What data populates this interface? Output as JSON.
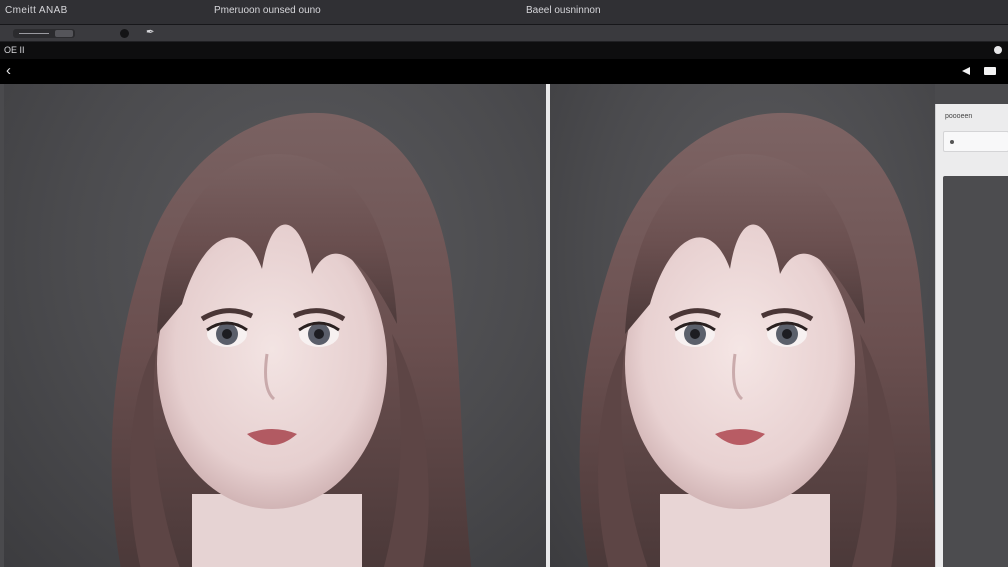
{
  "titlebar": {
    "app_title": "Cmeitt ANAB",
    "doc_title": "Pmeruoon ounsed ouno",
    "right_title": "Baeel ousninnon"
  },
  "toolbar": {
    "slider_value": "",
    "brush_glyph": "✒"
  },
  "subbar": {
    "label": "OE II"
  },
  "navbar": {
    "back_glyph": "‹"
  },
  "properties": {
    "title": "poooeen",
    "field_value": "•"
  },
  "colors": {
    "chrome_dark": "#303034",
    "canvas_bg": "#4a4a4d",
    "split_line": "#e9e9ea",
    "panel_bg": "#ececed"
  },
  "icons": [
    "brush-icon",
    "back-chevron-icon",
    "play-icon",
    "window-icon"
  ]
}
